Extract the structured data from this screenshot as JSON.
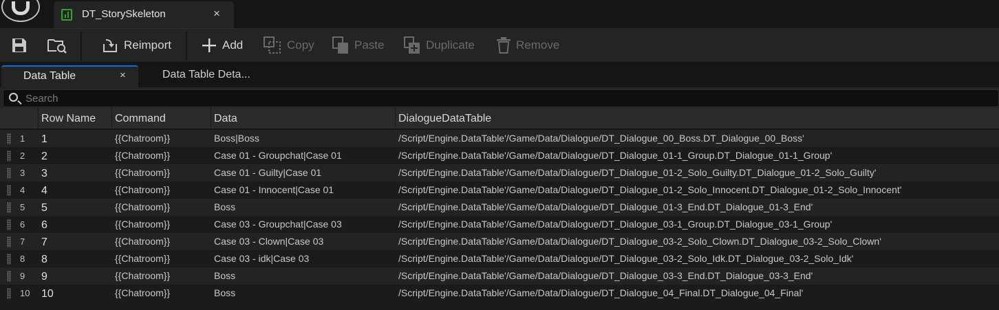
{
  "doc_tab": {
    "title": "DT_StorySkeleton",
    "close": "×"
  },
  "toolbar": {
    "reimport": "Reimport",
    "add": "Add",
    "copy": "Copy",
    "paste": "Paste",
    "duplicate": "Duplicate",
    "remove": "Remove"
  },
  "panel_tabs": {
    "active": "Data Table",
    "active_close": "×",
    "inactive": "Data Table Deta..."
  },
  "search": {
    "placeholder": "Search"
  },
  "table": {
    "columns": [
      "Row Name",
      "Command",
      "Data",
      "DialogueDataTable"
    ],
    "rows": [
      {
        "index": "1",
        "row_name": "1",
        "command": "{{Chatroom}}",
        "data": "Boss|Boss",
        "dialogue": "/Script/Engine.DataTable'/Game/Data/Dialogue/DT_Dialogue_00_Boss.DT_Dialogue_00_Boss'"
      },
      {
        "index": "2",
        "row_name": "2",
        "command": "{{Chatroom}}",
        "data": "Case 01 - Groupchat|Case 01",
        "dialogue": "/Script/Engine.DataTable'/Game/Data/Dialogue/DT_Dialogue_01-1_Group.DT_Dialogue_01-1_Group'"
      },
      {
        "index": "3",
        "row_name": "3",
        "command": "{{Chatroom}}",
        "data": "Case 01 - Guilty|Case 01",
        "dialogue": "/Script/Engine.DataTable'/Game/Data/Dialogue/DT_Dialogue_01-2_Solo_Guilty.DT_Dialogue_01-2_Solo_Guilty'"
      },
      {
        "index": "4",
        "row_name": "4",
        "command": "{{Chatroom}}",
        "data": "Case 01 - Innocent|Case 01",
        "dialogue": "/Script/Engine.DataTable'/Game/Data/Dialogue/DT_Dialogue_01-2_Solo_Innocent.DT_Dialogue_01-2_Solo_Innocent'"
      },
      {
        "index": "5",
        "row_name": "5",
        "command": "{{Chatroom}}",
        "data": "Boss",
        "dialogue": "/Script/Engine.DataTable'/Game/Data/Dialogue/DT_Dialogue_01-3_End.DT_Dialogue_01-3_End'"
      },
      {
        "index": "6",
        "row_name": "6",
        "command": "{{Chatroom}}",
        "data": "Case 03 - Groupchat|Case 03",
        "dialogue": "/Script/Engine.DataTable'/Game/Data/Dialogue/DT_Dialogue_03-1_Group.DT_Dialogue_03-1_Group'"
      },
      {
        "index": "7",
        "row_name": "7",
        "command": "{{Chatroom}}",
        "data": "Case 03 - Clown|Case 03",
        "dialogue": "/Script/Engine.DataTable'/Game/Data/Dialogue/DT_Dialogue_03-2_Solo_Clown.DT_Dialogue_03-2_Solo_Clown'"
      },
      {
        "index": "8",
        "row_name": "8",
        "command": "{{Chatroom}}",
        "data": "Case 03 - idk|Case 03",
        "dialogue": "/Script/Engine.DataTable'/Game/Data/Dialogue/DT_Dialogue_03-2_Solo_Idk.DT_Dialogue_03-2_Solo_Idk'"
      },
      {
        "index": "9",
        "row_name": "9",
        "command": "{{Chatroom}}",
        "data": "Boss",
        "dialogue": "/Script/Engine.DataTable'/Game/Data/Dialogue/DT_Dialogue_03-3_End.DT_Dialogue_03-3_End'"
      },
      {
        "index": "10",
        "row_name": "10",
        "command": "{{Chatroom}}",
        "data": "Boss",
        "dialogue": "/Script/Engine.DataTable'/Game/Data/Dialogue/DT_Dialogue_04_Final.DT_Dialogue_04_Final'"
      }
    ]
  },
  "icons": {
    "logo": "unreal-engine-logo",
    "doc": "data-table-icon",
    "save": "save-icon",
    "browse": "browse-to-asset-icon",
    "reimport": "reimport-icon",
    "add": "plus-icon",
    "copy": "copy-icon",
    "paste": "paste-icon",
    "duplicate": "duplicate-icon",
    "remove": "trash-icon",
    "search": "search-icon"
  },
  "colors": {
    "accent": "#0a72d6",
    "data_table_icon": "#2fa32f"
  }
}
